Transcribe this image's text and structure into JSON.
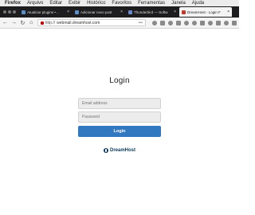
{
  "menubar": {
    "app": "Firefox",
    "items": [
      "Arquivo",
      "Editar",
      "Exibir",
      "Histórico",
      "Favoritos",
      "Ferramentas",
      "Janela",
      "Ajuda"
    ]
  },
  "tabs": [
    {
      "title": "Atualizar plugins • ..",
      "favicon": "wordpress-icon"
    },
    {
      "title": "Adicionar novo post",
      "favicon": "wordpress-icon"
    },
    {
      "title": "Thunderbird — Softw",
      "favicon": "thunderbird-icon"
    },
    {
      "title": "DreamHost - Login F",
      "favicon": "dreamhost-icon",
      "active": true
    }
  ],
  "url": {
    "protocol": "http://",
    "host": "webmail.dreamhost.com"
  },
  "login": {
    "title": "Login",
    "email_placeholder": "Email address",
    "password_placeholder": "Password",
    "button_label": "Login"
  },
  "logo": {
    "text": "DreamHost"
  },
  "colors": {
    "accent": "#3178c0",
    "brand": "#0a3a5c"
  }
}
